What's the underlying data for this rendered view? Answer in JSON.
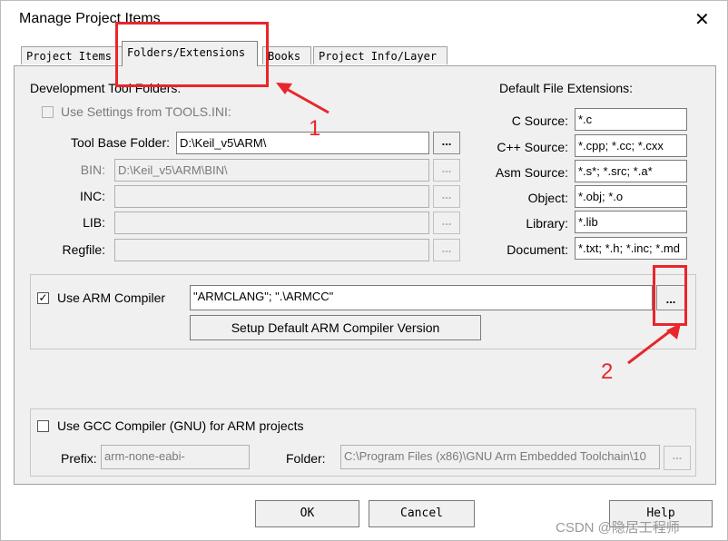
{
  "window": {
    "title": "Manage Project Items",
    "close_glyph": "✕"
  },
  "tabs": [
    {
      "label": "Project Items"
    },
    {
      "label": "Folders/Extensions",
      "active": true
    },
    {
      "label": "Books"
    },
    {
      "label": "Project Info/Layer"
    }
  ],
  "dev_folders": {
    "heading": "Development Tool Folders:",
    "use_tools_ini_label": "Use Settings from TOOLS.INI:",
    "tool_base_label": "Tool Base Folder:",
    "tool_base_value": "D:\\Keil_v5\\ARM\\",
    "bin_label": "BIN:",
    "bin_value": "D:\\Keil_v5\\ARM\\BIN\\",
    "inc_label": "INC:",
    "inc_value": "",
    "lib_label": "LIB:",
    "lib_value": "",
    "regfile_label": "Regfile:",
    "regfile_value": "",
    "browse_label": "..."
  },
  "extensions": {
    "heading": "Default File Extensions:",
    "c_label": "C Source:",
    "c_value": "*.c",
    "cpp_label": "C++ Source:",
    "cpp_value": "*.cpp; *.cc; *.cxx",
    "asm_label": "Asm Source:",
    "asm_value": "*.s*; *.src; *.a*",
    "obj_label": "Object:",
    "obj_value": "*.obj; *.o",
    "lib_label": "Library:",
    "lib_value": "*.lib",
    "doc_label": "Document:",
    "doc_value": "*.txt; *.h; *.inc; *.md"
  },
  "arm": {
    "use_label": "Use ARM Compiler",
    "checked": true,
    "value": "\"ARMCLANG\"; \".\\ARMCC\"",
    "browse_label": "...",
    "setup_button": "Setup Default ARM Compiler Version"
  },
  "gcc": {
    "use_label": "Use GCC Compiler (GNU) for ARM projects",
    "checked": false,
    "prefix_label": "Prefix:",
    "prefix_value": "arm-none-eabi-",
    "folder_label": "Folder:",
    "folder_value": "C:\\Program Files (x86)\\GNU Arm Embedded Toolchain\\10",
    "browse_label": "..."
  },
  "buttons": {
    "ok": "OK",
    "cancel": "Cancel",
    "help": "Help"
  },
  "annotations": {
    "num1": "1",
    "num2": "2",
    "accent": "#e8262b"
  },
  "watermark": "CSDN @隐居工程师",
  "colors": {
    "dialog_bg": "#f0f0f0",
    "annotation_red": "#e8262b"
  }
}
